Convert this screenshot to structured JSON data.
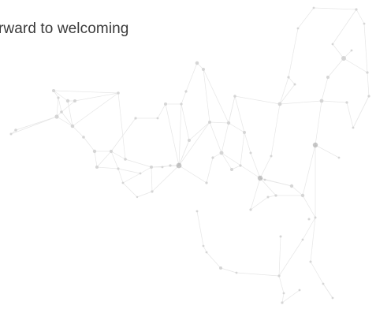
{
  "headline": {
    "text": "rward to welcoming"
  },
  "palette": {
    "line": "#e6e6e6",
    "node": "#d2d2d2",
    "node_dark": "#9a9a9a",
    "text": "#3a3a3a"
  }
}
